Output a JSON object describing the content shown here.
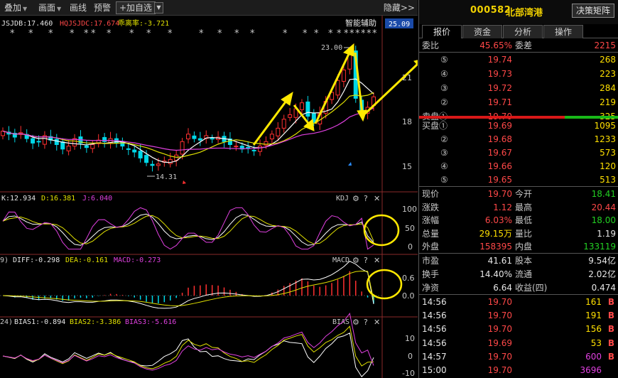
{
  "toolbar": {
    "overlay": "叠加",
    "canvas": "画面",
    "draw": "画线",
    "alert": "预警",
    "add_favorite": "+加自选",
    "hide": "隐藏>>"
  },
  "main_chart": {
    "ind1_label": "JSJDB:17.460",
    "ind2_label": "HQJSJDC:17.674",
    "ind3_label": "乖离率:-3.721",
    "smart_assist": "智能辅助",
    "price_tag": "25.09",
    "high_label": "23.00",
    "low_label": "14.31",
    "y_ticks": [
      "21",
      "18",
      "15"
    ]
  },
  "kdj": {
    "k": "K:12.934",
    "d": "D:16.381",
    "j": "J:6.040",
    "name": "KDJ",
    "ticks": [
      "100",
      "50",
      "0"
    ]
  },
  "macd": {
    "params": "9)",
    "diff": "DIFF:-0.298",
    "dea": "DEA:-0.161",
    "macd": "MACD:-0.273",
    "name": "MACD",
    "ticks": [
      "0.6",
      "0.0"
    ]
  },
  "bias": {
    "params": "24)",
    "b1": "BIAS1:-0.894",
    "b2": "BIAS2:-3.386",
    "b3": "BIAS3:-5.616",
    "name": "BIAS",
    "ticks": [
      "10",
      "0",
      "-10"
    ]
  },
  "stock": {
    "code": "000582",
    "name": "北部湾港",
    "decision": "决策矩阵"
  },
  "tabs": [
    "报价",
    "资金",
    "分析",
    "操作"
  ],
  "order": {
    "ratio_label": "委比",
    "ratio": "45.65%",
    "diff_label": "委差",
    "diff": "2215"
  },
  "sell": [
    {
      "lv": "⑤",
      "price": "19.74",
      "vol": "268"
    },
    {
      "lv": "④",
      "price": "19.73",
      "vol": "223"
    },
    {
      "lv": "③",
      "price": "19.72",
      "vol": "284"
    },
    {
      "lv": "②",
      "price": "19.71",
      "vol": "219"
    },
    {
      "lv": "卖盘①",
      "price": "19.70",
      "vol": "325"
    }
  ],
  "buy": [
    {
      "lv": "买盘①",
      "price": "19.69",
      "vol": "1095"
    },
    {
      "lv": "②",
      "price": "19.68",
      "vol": "1233"
    },
    {
      "lv": "③",
      "price": "19.67",
      "vol": "573"
    },
    {
      "lv": "④",
      "price": "19.66",
      "vol": "120"
    },
    {
      "lv": "⑤",
      "price": "19.65",
      "vol": "513"
    }
  ],
  "quote": [
    {
      "l1": "现价",
      "v1": "19.70",
      "c1": "red",
      "l2": "今开",
      "v2": "18.41",
      "c2": "green"
    },
    {
      "l1": "涨跌",
      "v1": "1.12",
      "c1": "red",
      "l2": "最高",
      "v2": "20.44",
      "c2": "red"
    },
    {
      "l1": "涨幅",
      "v1": "6.03%",
      "c1": "red",
      "l2": "最低",
      "v2": "18.00",
      "c2": "green"
    },
    {
      "l1": "总量",
      "v1": "29.15万",
      "c1": "yellow",
      "l2": "量比",
      "v2": "1.19",
      "c2": "white"
    },
    {
      "l1": "外盘",
      "v1": "158395",
      "c1": "red",
      "l2": "内盘",
      "v2": "133119",
      "c2": "green"
    }
  ],
  "finance": [
    {
      "l1": "市盈",
      "v1": "41.61",
      "l2": "股本",
      "v2": "9.54亿"
    },
    {
      "l1": "换手",
      "v1": "14.40%",
      "l2": "流通",
      "v2": "2.02亿"
    },
    {
      "l1": "净资",
      "v1": "6.64",
      "l2": "收益(四)",
      "v2": "0.474"
    }
  ],
  "ticks": [
    {
      "time": "14:56",
      "price": "19.70",
      "vol": "161",
      "side": "B",
      "volc": "yellow"
    },
    {
      "time": "14:56",
      "price": "19.70",
      "vol": "191",
      "side": "B",
      "volc": "yellow"
    },
    {
      "time": "14:56",
      "price": "19.70",
      "vol": "156",
      "side": "B",
      "volc": "yellow"
    },
    {
      "time": "14:56",
      "price": "19.69",
      "vol": "53",
      "side": "B",
      "volc": "yellow"
    },
    {
      "time": "14:57",
      "price": "19.70",
      "vol": "600",
      "side": "B",
      "volc": "mag"
    },
    {
      "time": "15:00",
      "price": "19.70",
      "vol": "3696",
      "side": "",
      "volc": "mag"
    }
  ],
  "chart_data": {
    "type": "candlestick",
    "price_axis_ticks": [
      21,
      18,
      15
    ],
    "high": 23.0,
    "low": 14.31,
    "close": [
      17.4,
      17.2,
      17.0,
      17.3,
      16.9,
      16.6,
      16.7,
      17.1,
      16.8,
      16.5,
      16.2,
      16.4,
      16.9,
      16.6,
      16.3,
      16.5,
      16.8,
      16.7,
      16.9,
      16.6,
      16.4,
      16.2,
      16.0,
      15.6,
      15.3,
      15.1,
      15.2,
      15.4,
      15.5,
      15.8,
      16.7,
      17.2,
      16.9,
      16.8,
      17.1,
      16.9,
      17.0,
      16.7,
      16.5,
      16.4,
      16.2,
      16.3,
      16.1,
      16.4,
      16.7,
      17.2,
      17.6,
      18.2,
      18.5,
      18.9,
      19.3,
      18.4,
      18.0,
      18.6,
      19.4,
      20.0,
      20.8,
      21.5,
      22.6,
      19.6,
      18.6,
      19.0,
      19.7
    ],
    "ma_colors": [
      "#ffffff",
      "#e0e000",
      "#e040e0"
    ],
    "kdj": {
      "k": 12.934,
      "d": 16.381,
      "j": 6.04
    },
    "macd": {
      "diff": -0.298,
      "dea": -0.161,
      "macd": -0.273
    },
    "bias": {
      "bias1": -0.894,
      "bias2": -3.386,
      "bias3": -5.616
    }
  }
}
